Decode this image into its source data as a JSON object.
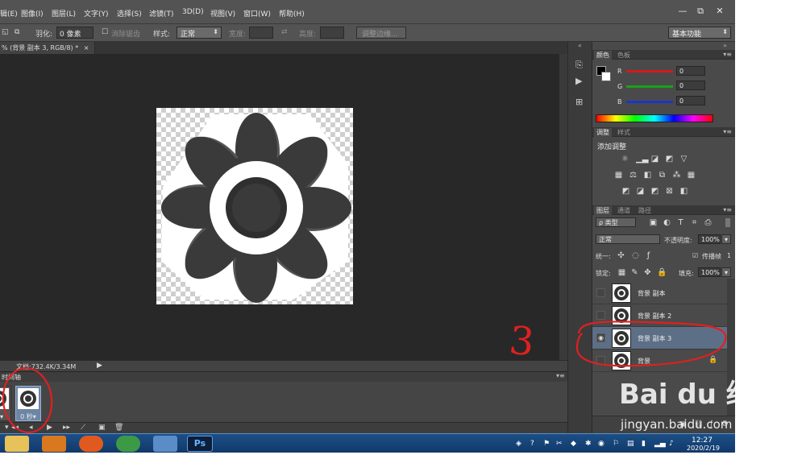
{
  "menubar": {
    "items": [
      "辑(E)",
      "图像(I)",
      "图层(L)",
      "文字(Y)",
      "选择(S)",
      "滤镜(T)",
      "3D(D)",
      "视图(V)",
      "窗口(W)",
      "帮助(H)"
    ],
    "window_buttons": [
      "—",
      "⧉",
      "✕"
    ]
  },
  "options": {
    "feather_label": "羽化:",
    "feather_value": "0 像素",
    "antialias_label": "消除锯齿",
    "style_label": "样式:",
    "style_value": "正常",
    "width_label": "宽度:",
    "height_label": "高度:",
    "refine_button": "调整边缘...",
    "workspace": "基本功能"
  },
  "document": {
    "tab_label": "% (背景 副本 3, RGB/8) *",
    "tab_close": "×",
    "status": "文档:732.4K/3.34M"
  },
  "timeline": {
    "title": "时间轴",
    "frames": [
      {
        "label": "秒▾"
      },
      {
        "label": "0 秒▾"
      }
    ]
  },
  "color_panel": {
    "tabs": [
      "颜色",
      "色板"
    ],
    "channels": [
      {
        "name": "R",
        "value": "0",
        "color": "#d21a1a"
      },
      {
        "name": "G",
        "value": "0",
        "color": "#1aa11a"
      },
      {
        "name": "B",
        "value": "0",
        "color": "#1a36c9"
      }
    ]
  },
  "adjustments_panel": {
    "tabs": [
      "调整",
      "样式"
    ],
    "heading": "添加调整"
  },
  "layers_panel": {
    "tabs": [
      "图层",
      "通道",
      "路径"
    ],
    "filter_label": "ρ 类型",
    "blend_mode": "正常",
    "opacity_label": "不透明度:",
    "opacity_value": "100%",
    "unify_label": "统一:",
    "propagate_label": "传播帧",
    "propagate_num": "1",
    "lock_label": "锁定:",
    "fill_label": "填充:",
    "fill_value": "100%",
    "layers": [
      {
        "name": "背景 副本",
        "visible": false,
        "selected": false,
        "locked": false
      },
      {
        "name": "背景 副本 2",
        "visible": false,
        "selected": false,
        "locked": false
      },
      {
        "name": "背景 副本 3",
        "visible": true,
        "selected": true,
        "locked": false
      },
      {
        "name": "背景",
        "visible": false,
        "selected": false,
        "locked": true
      }
    ]
  },
  "taskbar": {
    "time": "12:27",
    "date": "2020/2/19",
    "ps_label": "Ps"
  },
  "annotations": {
    "number_mark": "3"
  },
  "watermark": {
    "logo": "Bai du 经验",
    "url": "jingyan.baidu.com"
  }
}
